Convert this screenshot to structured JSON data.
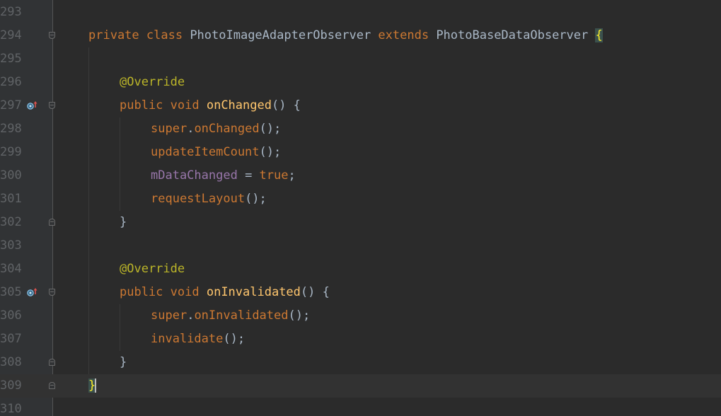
{
  "editor": {
    "lines": [
      {
        "num": "293",
        "tokens": []
      },
      {
        "num": "294",
        "fold": "start",
        "tokens": [
          {
            "t": "private ",
            "c": "kw"
          },
          {
            "t": "class ",
            "c": "kw"
          },
          {
            "t": "PhotoImageAdapterObserver ",
            "c": "plain"
          },
          {
            "t": "extends ",
            "c": "kw"
          },
          {
            "t": "PhotoBaseDataObserver ",
            "c": "plain"
          },
          {
            "t": "{",
            "c": "brace-hl"
          }
        ]
      },
      {
        "num": "295",
        "tokens": []
      },
      {
        "num": "296",
        "tokens": [
          {
            "t": "@Override",
            "c": "ann"
          }
        ]
      },
      {
        "num": "297",
        "fold": "start",
        "marker": "override-gutter-icon",
        "tokens": [
          {
            "t": "public ",
            "c": "kw"
          },
          {
            "t": "void ",
            "c": "kw"
          },
          {
            "t": "onChanged",
            "c": "mdecl"
          },
          {
            "t": "() {",
            "c": "plain"
          }
        ]
      },
      {
        "num": "298",
        "tokens": [
          {
            "t": "super",
            "c": "kw"
          },
          {
            "t": ".",
            "c": "plain"
          },
          {
            "t": "onChanged",
            "c": "kw"
          },
          {
            "t": "();",
            "c": "plain"
          }
        ]
      },
      {
        "num": "299",
        "tokens": [
          {
            "t": "updateItemCount",
            "c": "kw"
          },
          {
            "t": "();",
            "c": "plain"
          }
        ]
      },
      {
        "num": "300",
        "tokens": [
          {
            "t": "mDataChanged",
            "c": "field"
          },
          {
            "t": " = ",
            "c": "plain"
          },
          {
            "t": "true",
            "c": "kw"
          },
          {
            "t": ";",
            "c": "plain"
          }
        ]
      },
      {
        "num": "301",
        "tokens": [
          {
            "t": "requestLayout",
            "c": "kw"
          },
          {
            "t": "();",
            "c": "plain"
          }
        ]
      },
      {
        "num": "302",
        "fold": "end",
        "tokens": [
          {
            "t": "}",
            "c": "plain"
          }
        ]
      },
      {
        "num": "303",
        "tokens": []
      },
      {
        "num": "304",
        "tokens": [
          {
            "t": "@Override",
            "c": "ann"
          }
        ]
      },
      {
        "num": "305",
        "fold": "start",
        "marker": "override-gutter-icon",
        "tokens": [
          {
            "t": "public ",
            "c": "kw"
          },
          {
            "t": "void ",
            "c": "kw"
          },
          {
            "t": "onInvalidated",
            "c": "mdecl"
          },
          {
            "t": "() {",
            "c": "plain"
          }
        ]
      },
      {
        "num": "306",
        "tokens": [
          {
            "t": "super",
            "c": "kw"
          },
          {
            "t": ".",
            "c": "plain"
          },
          {
            "t": "onInvalidated",
            "c": "kw"
          },
          {
            "t": "();",
            "c": "plain"
          }
        ]
      },
      {
        "num": "307",
        "tokens": [
          {
            "t": "invalidate",
            "c": "kw"
          },
          {
            "t": "();",
            "c": "plain"
          }
        ]
      },
      {
        "num": "308",
        "fold": "end",
        "tokens": [
          {
            "t": "}",
            "c": "plain"
          }
        ]
      },
      {
        "num": "309",
        "fold": "end",
        "current": true,
        "caret": true,
        "tokens": [
          {
            "t": "}",
            "c": "brace-hl"
          }
        ]
      },
      {
        "num": "310",
        "tokens": []
      }
    ]
  },
  "colors": {
    "background": "#2b2b2b",
    "gutter": "#313335",
    "keyword": "#cc7832",
    "plain": "#a9b7c6",
    "annotation": "#bbb529",
    "method_declaration": "#ffc66d",
    "field": "#9876aa",
    "line_number": "#606366"
  }
}
